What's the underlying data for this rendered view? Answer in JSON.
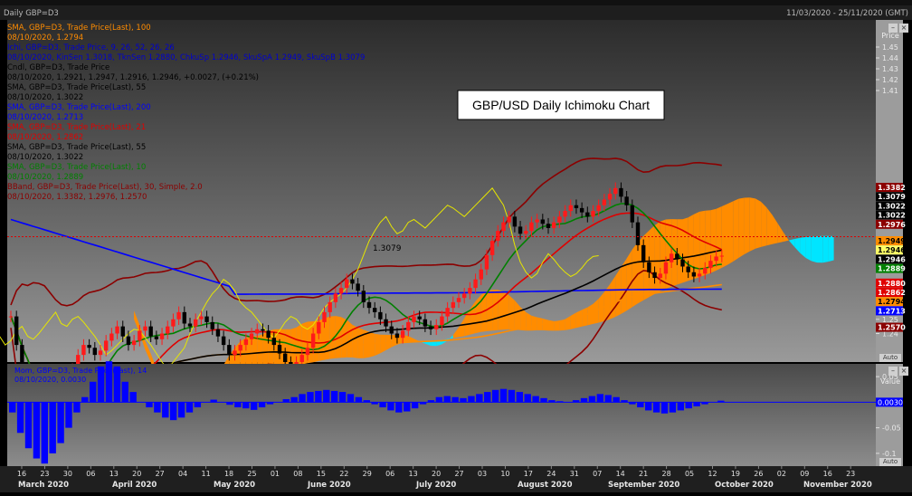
{
  "window": {
    "title": "Daily GBP=D3",
    "date_range": "11/03/2020 - 25/11/2020 (GMT)"
  },
  "colors": {
    "background_top": "#2a2a2a",
    "background_bottom": "#8a8a8a",
    "cloud_bull": "#ff8c00",
    "cloud_bear": "#00e5ff",
    "up_candle": "#ff1a1a",
    "down_candle": "#000000",
    "momentum": "#0000ff"
  },
  "legend": [
    {
      "text": "SMA, GBP=D3, Trade Price(Last), 100",
      "color": "#ff8c00"
    },
    {
      "text": "08/10/2020, 1.2794",
      "color": "#ff8c00"
    },
    {
      "text": "Ichi, GBP=D3, Trade Price, 9, 26, 52, 26, 26",
      "color": "#0000cc"
    },
    {
      "text": "08/10/2020, KinSen 1.3018, TknSen 1.2880, ChkuSp 1.2946, SkuSpA 1.2949, SkuSpB 1.3079",
      "color": "#0000cc"
    },
    {
      "text": "Cndl, GBP=D3, Trade Price",
      "color": "#000000"
    },
    {
      "text": "08/10/2020, 1.2921, 1.2947, 1.2916, 1.2946, +0.0027, (+0.21%)",
      "color": "#000000"
    },
    {
      "text": "SMA, GBP=D3, Trade Price(Last), 55",
      "color": "#000000"
    },
    {
      "text": "08/10/2020, 1.3022",
      "color": "#000000"
    },
    {
      "text": "SMA, GBP=D3, Trade Price(Last), 200",
      "color": "#0000ff"
    },
    {
      "text": "08/10/2020, 1.2713",
      "color": "#0000ff"
    },
    {
      "text": "SMA, GBP=D3, Trade Price(Last), 21",
      "color": "#e00000"
    },
    {
      "text": "08/10/2020, 1.2862",
      "color": "#e00000"
    },
    {
      "text": "SMA, GBP=D3, Trade Price(Last), 55",
      "color": "#000000"
    },
    {
      "text": "08/10/2020, 1.3022",
      "color": "#000000"
    },
    {
      "text": "SMA, GBP=D3, Trade Price(Last), 10",
      "color": "#008000"
    },
    {
      "text": "08/10/2020, 1.2889",
      "color": "#008000"
    },
    {
      "text": "BBand, GBP=D3, Trade Price(Last), 30, Simple, 2.0",
      "color": "#8b0000"
    },
    {
      "text": "08/10/2020, 1.3382, 1.2976, 1.2570",
      "color": "#8b0000"
    }
  ],
  "chart_data": [
    {
      "type": "candlestick",
      "title": "GBP/USD Daily Ichimoku Chart",
      "annotation": "1.3079",
      "y_axis_title": "Price",
      "ylim": [
        1.22,
        1.46
      ],
      "y_ticks": [
        1.24,
        1.25,
        1.26,
        1.27,
        1.28,
        1.29,
        1.3,
        1.31,
        1.32,
        1.33,
        1.34,
        1.35,
        1.36,
        1.37,
        1.38,
        1.39,
        1.4,
        1.41,
        1.42,
        1.43,
        1.44,
        1.45
      ],
      "y_ticks_shown": [
        "1.45",
        "1.44",
        "1.43",
        "1.42",
        "1.41",
        "1.25",
        "1.24"
      ],
      "reference_line": 1.3079,
      "price_labels": [
        {
          "text": "1.3382",
          "value": 1.3382,
          "bg": "#8b0000",
          "fg": "#ffffff"
        },
        {
          "text": "1.3079",
          "value": 1.3079,
          "bg": "#000000",
          "fg": "#ffffff"
        },
        {
          "text": "1.3022",
          "value": 1.3022,
          "bg": "#000000",
          "fg": "#ffffff"
        },
        {
          "text": "1.3022",
          "value": 1.3022,
          "bg": "#000000",
          "fg": "#ffffff"
        },
        {
          "text": "1.2976",
          "value": 1.2976,
          "bg": "#8b0000",
          "fg": "#ffffff"
        },
        {
          "text": "1.2949",
          "value": 1.2949,
          "bg": "#ff8c00",
          "fg": "#000000"
        },
        {
          "text": "1.2946",
          "value": 1.2946,
          "bg": "#ffff66",
          "fg": "#000000"
        },
        {
          "text": "1.2946",
          "value": 1.2946,
          "bg": "#000000",
          "fg": "#ffffff"
        },
        {
          "text": "1.2889",
          "value": 1.2889,
          "bg": "#008000",
          "fg": "#ffffff"
        },
        {
          "text": "1.2880",
          "value": 1.288,
          "bg": "#e00000",
          "fg": "#ffffff"
        },
        {
          "text": "1.2862",
          "value": 1.2862,
          "bg": "#e00000",
          "fg": "#ffffff"
        },
        {
          "text": "1.2794",
          "value": 1.2794,
          "bg": "#ff8c00",
          "fg": "#000000"
        },
        {
          "text": "1.2713",
          "value": 1.2713,
          "bg": "#0000ff",
          "fg": "#ffffff"
        },
        {
          "text": "1.2570",
          "value": 1.257,
          "bg": "#8b0000",
          "fg": "#ffffff"
        }
      ],
      "close_series": [
        1.252,
        1.232,
        1.208,
        1.195,
        1.172,
        1.16,
        1.15,
        1.16,
        1.175,
        1.19,
        1.205,
        1.215,
        1.225,
        1.232,
        1.23,
        1.225,
        1.228,
        1.235,
        1.24,
        1.245,
        1.238,
        1.232,
        1.235,
        1.242,
        1.245,
        1.238,
        1.236,
        1.24,
        1.245,
        1.25,
        1.255,
        1.247,
        1.245,
        1.25,
        1.252,
        1.248,
        1.243,
        1.238,
        1.232,
        1.225,
        1.228,
        1.232,
        1.236,
        1.24,
        1.243,
        1.242,
        1.237,
        1.232,
        1.226,
        1.22,
        1.215,
        1.22,
        1.225,
        1.23,
        1.24,
        1.248,
        1.255,
        1.262,
        1.268,
        1.272,
        1.278,
        1.275,
        1.27,
        1.262,
        1.258,
        1.255,
        1.25,
        1.245,
        1.24,
        1.237,
        1.242,
        1.248,
        1.252,
        1.25,
        1.245,
        1.243,
        1.246,
        1.252,
        1.258,
        1.262,
        1.265,
        1.268,
        1.272,
        1.278,
        1.285,
        1.295,
        1.305,
        1.312,
        1.318,
        1.322,
        1.315,
        1.31,
        1.312,
        1.318,
        1.32,
        1.317,
        1.314,
        1.318,
        1.322,
        1.326,
        1.33,
        1.328,
        1.325,
        1.322,
        1.326,
        1.33,
        1.334,
        1.338,
        1.342,
        1.336,
        1.33,
        1.318,
        1.302,
        1.29,
        1.283,
        1.279,
        1.282,
        1.29,
        1.296,
        1.292,
        1.287,
        1.283,
        1.28,
        1.282,
        1.286,
        1.291,
        1.294,
        1.2946
      ],
      "series": [
        {
          "name": "SMA 100",
          "color": "#ff8c00"
        },
        {
          "name": "SMA 55",
          "color": "#000000"
        },
        {
          "name": "SMA 200",
          "color": "#0000ff"
        },
        {
          "name": "SMA 21",
          "color": "#e00000"
        },
        {
          "name": "SMA 10",
          "color": "#008000"
        },
        {
          "name": "BBand 30",
          "color": "#8b0000"
        },
        {
          "name": "Chikou",
          "color": "#e6e600"
        }
      ]
    },
    {
      "type": "bar",
      "title": "Mom, GBP=D3, Trade Price(Last), 14",
      "subtitle": "08/10/2020, 0.0030",
      "y_axis_title": "Value",
      "ylim": [
        -0.125,
        0.075
      ],
      "y_ticks": [
        0.05,
        0.0,
        -0.05,
        -0.1
      ],
      "y_ticks_shown": [
        "0.05",
        "-0.05",
        "-0.1"
      ],
      "value_label": "0.0030",
      "values": [
        -0.02,
        -0.06,
        -0.09,
        -0.11,
        -0.12,
        -0.1,
        -0.08,
        -0.05,
        -0.02,
        0.01,
        0.04,
        0.07,
        0.08,
        0.07,
        0.04,
        0.02,
        0.0,
        -0.01,
        -0.02,
        -0.03,
        -0.035,
        -0.03,
        -0.02,
        -0.01,
        0.0,
        0.005,
        0.0,
        -0.005,
        -0.01,
        -0.012,
        -0.015,
        -0.01,
        -0.004,
        0.0,
        0.006,
        0.01,
        0.016,
        0.02,
        0.022,
        0.024,
        0.022,
        0.02,
        0.016,
        0.01,
        0.004,
        -0.004,
        -0.01,
        -0.016,
        -0.02,
        -0.018,
        -0.012,
        -0.004,
        0.004,
        0.01,
        0.012,
        0.01,
        0.008,
        0.012,
        0.016,
        0.02,
        0.024,
        0.026,
        0.024,
        0.02,
        0.016,
        0.012,
        0.008,
        0.004,
        0.002,
        0.0,
        0.004,
        0.008,
        0.012,
        0.016,
        0.014,
        0.01,
        0.004,
        -0.004,
        -0.01,
        -0.016,
        -0.02,
        -0.022,
        -0.02,
        -0.016,
        -0.012,
        -0.008,
        -0.004,
        0.0,
        0.003
      ]
    }
  ],
  "x_axis": {
    "day_ticks": [
      "16",
      "23",
      "30",
      "06",
      "13",
      "20",
      "27",
      "04",
      "11",
      "18",
      "25",
      "01",
      "08",
      "15",
      "22",
      "29",
      "06",
      "13",
      "20",
      "27",
      "03",
      "10",
      "17",
      "24",
      "31",
      "07",
      "14",
      "21",
      "28",
      "05",
      "12",
      "19",
      "26",
      "02",
      "09",
      "16",
      "23"
    ],
    "months": [
      "March 2020",
      "April 2020",
      "May 2020",
      "June 2020",
      "July 2020",
      "August 2020",
      "September 2020",
      "October 2020",
      "November 2020"
    ]
  },
  "controls": {
    "auto_label": "Auto",
    "auto_label2": "Auto"
  }
}
